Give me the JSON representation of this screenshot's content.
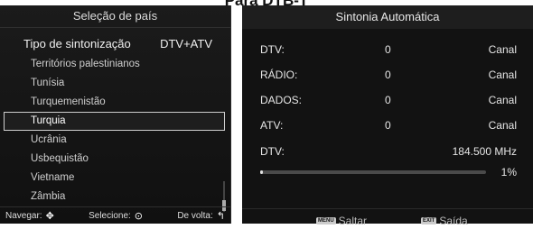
{
  "left": {
    "title": "Seleção de país",
    "tuning_label": "Tipo de sintonização",
    "tuning_value": "DTV+ATV",
    "countries": [
      {
        "name": "Territórios palestinianos",
        "selected": false
      },
      {
        "name": "Tunísia",
        "selected": false
      },
      {
        "name": "Turquemenistão",
        "selected": false
      },
      {
        "name": "Turquia",
        "selected": true
      },
      {
        "name": "Ucrânia",
        "selected": false
      },
      {
        "name": "Usbequistão",
        "selected": false
      },
      {
        "name": "Vietname",
        "selected": false
      },
      {
        "name": "Zâmbia",
        "selected": false
      }
    ],
    "footer": {
      "navigate_label": "Navegar:",
      "select_label": "Selecione:",
      "back_label": "De volta:"
    }
  },
  "right": {
    "title": "Sintonia Automática",
    "stats": [
      {
        "label": "DTV:",
        "value": "0",
        "unit": "Canal"
      },
      {
        "label": "RÁDIO:",
        "value": "0",
        "unit": "Canal"
      },
      {
        "label": "DADOS:",
        "value": "0",
        "unit": "Canal"
      },
      {
        "label": "ATV:",
        "value": "0",
        "unit": "Canal"
      }
    ],
    "freq_label": "DTV:",
    "freq_value": "184.500 MHz",
    "progress_percent": 1,
    "progress_text": "1%",
    "footer": {
      "skip_key": "MENU",
      "skip_label": "Saltar",
      "exit_key": "EXIT",
      "exit_label": "Saída"
    }
  }
}
